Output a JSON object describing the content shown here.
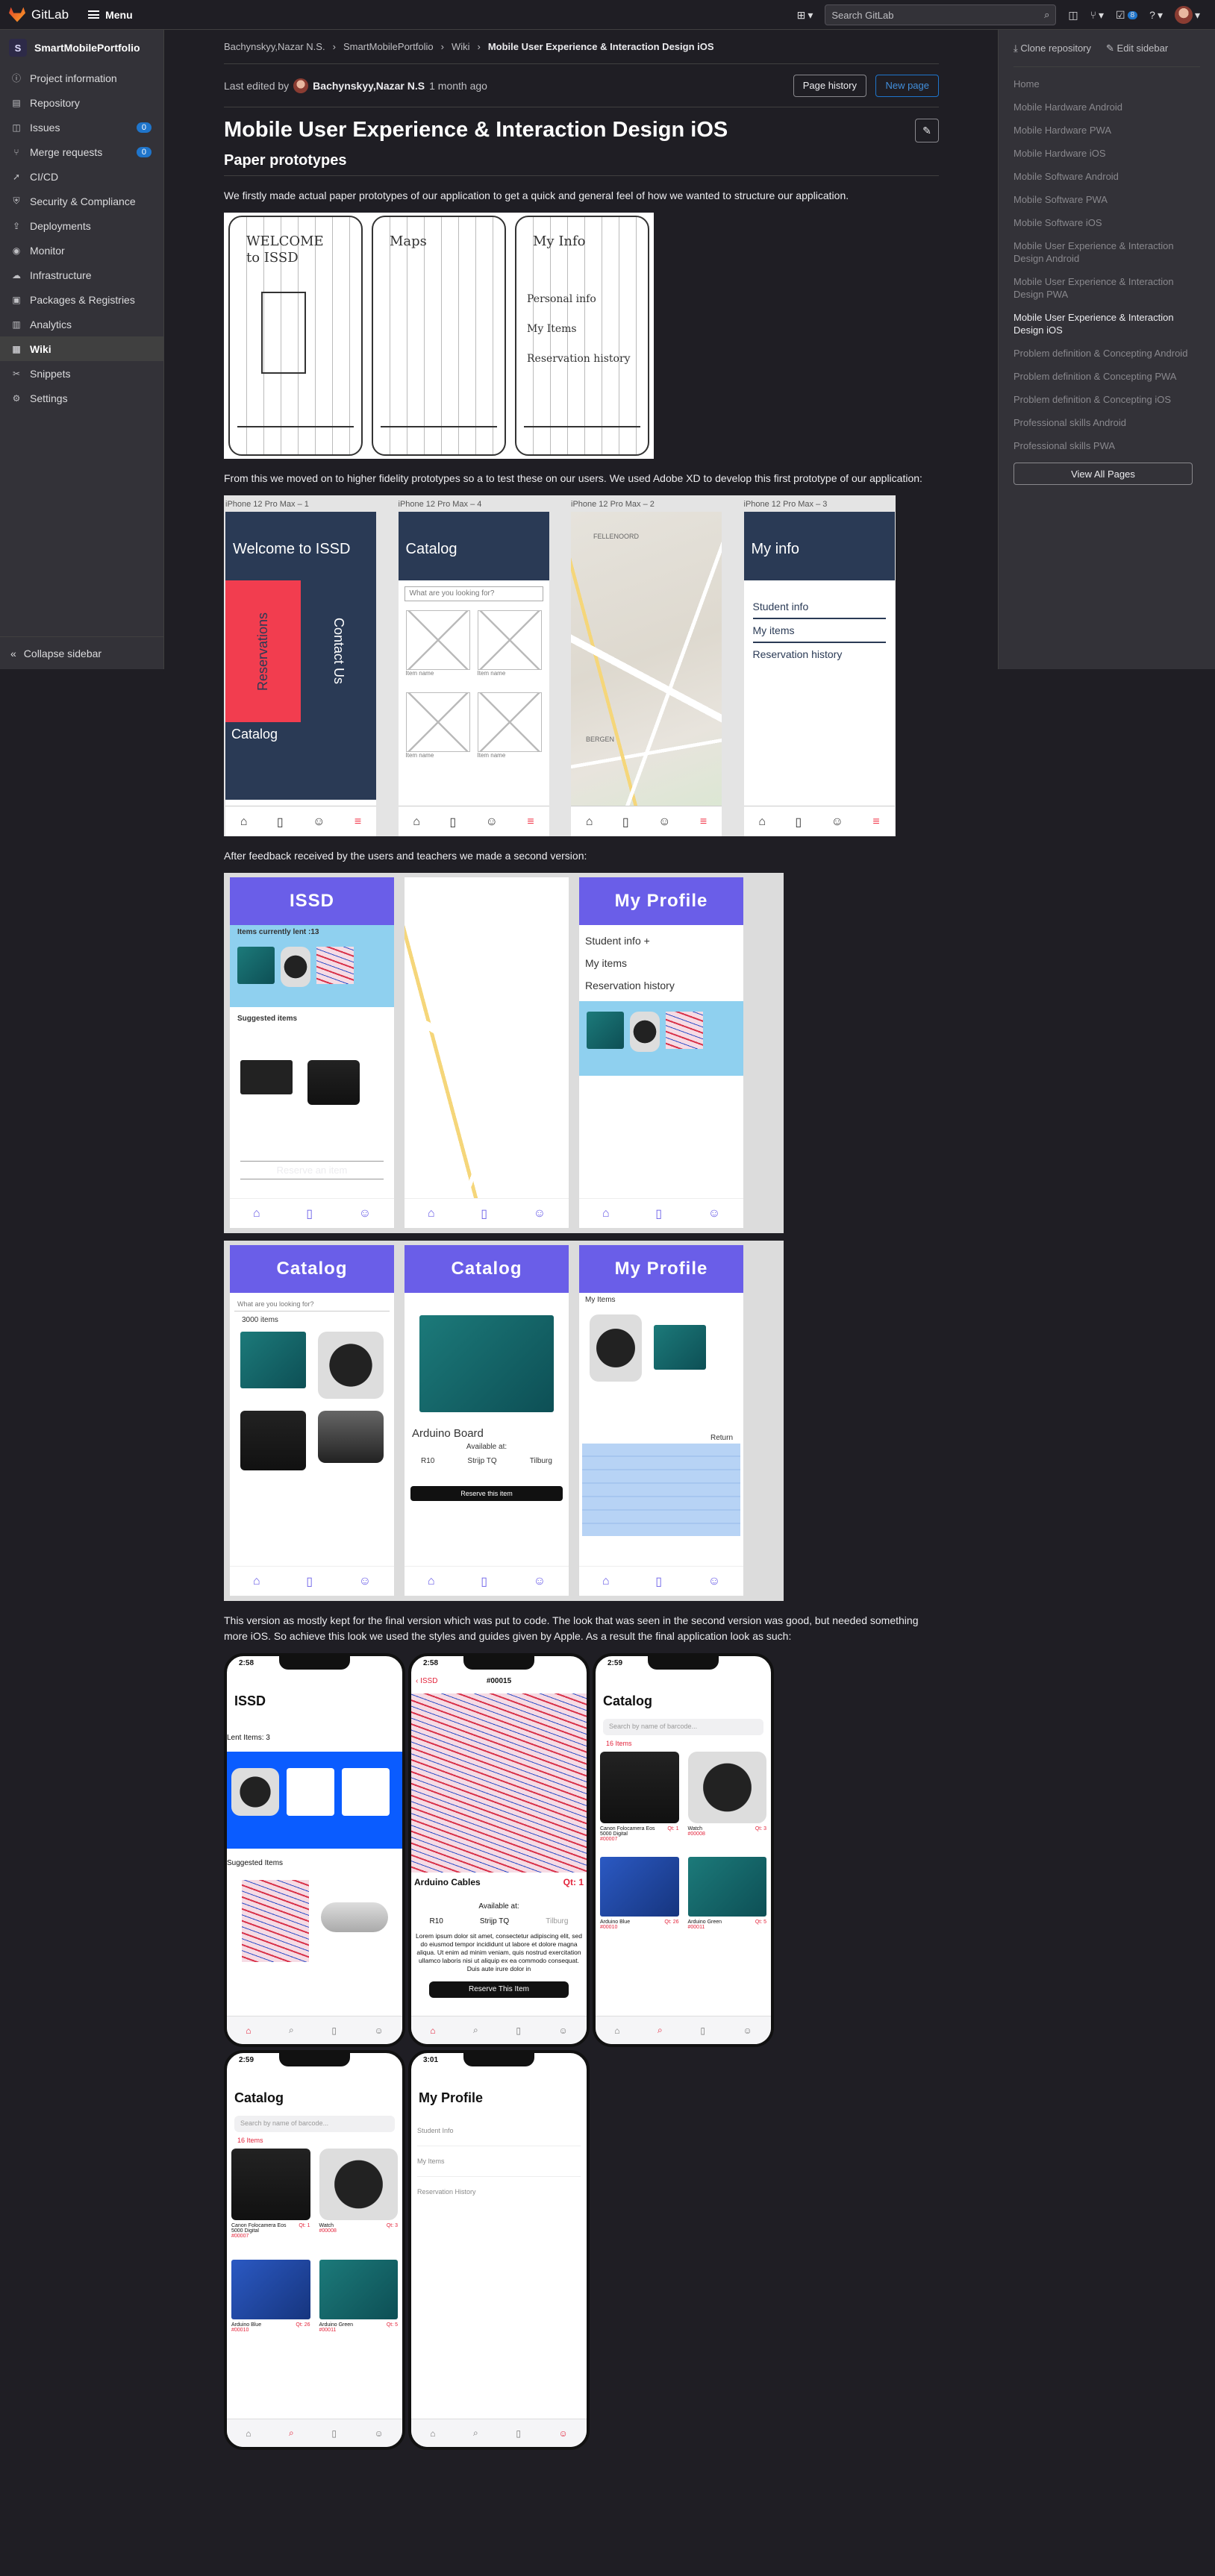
{
  "topbar": {
    "brand": "GitLab",
    "menu_label": "Menu",
    "search_placeholder": "Search GitLab",
    "todo_count": "8"
  },
  "sidebar": {
    "project_initial": "S",
    "project_name": "SmartMobilePortfolio",
    "items": [
      {
        "label": "Project information",
        "icon": "info-icon"
      },
      {
        "label": "Repository",
        "icon": "doc-icon"
      },
      {
        "label": "Issues",
        "icon": "issues-icon",
        "count": "0"
      },
      {
        "label": "Merge requests",
        "icon": "merge-icon",
        "count": "0"
      },
      {
        "label": "CI/CD",
        "icon": "rocket-icon"
      },
      {
        "label": "Security & Compliance",
        "icon": "shield-icon"
      },
      {
        "label": "Deployments",
        "icon": "deploy-icon"
      },
      {
        "label": "Monitor",
        "icon": "monitor-icon"
      },
      {
        "label": "Infrastructure",
        "icon": "cloud-icon"
      },
      {
        "label": "Packages & Registries",
        "icon": "package-icon"
      },
      {
        "label": "Analytics",
        "icon": "chart-icon"
      },
      {
        "label": "Wiki",
        "icon": "book-icon",
        "active": true
      },
      {
        "label": "Snippets",
        "icon": "snippet-icon"
      },
      {
        "label": "Settings",
        "icon": "gear-icon"
      }
    ],
    "collapse_label": "Collapse sidebar"
  },
  "breadcrumb": [
    "Bachynskyy,Nazar N.S.",
    "SmartMobilePortfolio",
    "Wiki",
    "Mobile User Experience & Interaction Design iOS"
  ],
  "header": {
    "last_edited_prefix": "Last edited by",
    "author": "Bachynskyy,Nazar N.S",
    "when": "1 month ago",
    "page_history": "Page history",
    "new_page": "New page"
  },
  "page": {
    "title": "Mobile User Experience & Interaction Design iOS",
    "section_title": "Paper prototypes",
    "p1": "We firstly made actual paper prototypes of our application to get a quick and general feel of how we wanted to structure our application.",
    "p2": "From this we moved on to higher fidelity prototypes so a to test these on our users. We used Adobe XD to develop this first prototype of our application:",
    "p3": "After feedback received by the users and teachers we made a second version:",
    "p4": "This version as mostly kept for the final version which was put to code. The look that was seen in the second version was good, but needed something more iOS. So achieve this look we used the styles and guides given by Apple. As a result the final application look as such:"
  },
  "sketch": {
    "s1": "WELCOME to ISSD",
    "s2": "Maps",
    "s3": "My Info",
    "s3_items": [
      "Personal info",
      "My Items",
      "Reservation history"
    ]
  },
  "xd": {
    "labels": [
      "iPhone 12 Pro Max – 1",
      "iPhone 12 Pro Max – 4",
      "iPhone 12 Pro Max – 2",
      "iPhone 12 Pro Max – 3"
    ],
    "welcome": "Welcome to ISSD",
    "reservations": "Reservations",
    "contact": "Contact Us",
    "catalog": "Catalog",
    "search": "What are you looking for?",
    "item_name": "Item name",
    "myinfo": "My info",
    "myinfo_items": [
      "Student info",
      "My items",
      "Reservation history"
    ],
    "map_labels": [
      "FELLENOORD",
      "BERGEN"
    ]
  },
  "v2": {
    "issd": "ISSD",
    "lent": "Items currently lent :13",
    "suggested": "Suggested items",
    "reserve": "Reserve an item",
    "profile": "My Profile",
    "profile_items": [
      "Student info +",
      "My items",
      "Reservation history"
    ],
    "catalog": "Catalog",
    "search": "What are you looking for?",
    "count": "3000 items",
    "detail_title": "Arduino Board",
    "available": "Available at:",
    "locations": [
      "R10",
      "Strijp TQ",
      "Tilburg"
    ],
    "reserve_this": "Reserve this item",
    "my_items": "My Items",
    "return": "Return"
  },
  "final": {
    "time1": "2:58",
    "time2": "2:59",
    "time3": "3:01",
    "issd": "ISSD",
    "lent": "Lent Items: 3",
    "suggested": "Suggested Items",
    "back": "ISSD",
    "detail_id": "#00015",
    "detail_name": "Arduino Cables",
    "detail_qty": "Qt: 1",
    "available": "Available at:",
    "locations": [
      "R10",
      "Strijp TQ",
      "Tilburg"
    ],
    "lorem": "Lorem ipsum dolor sit amet, consectetur adipiscing elit, sed do eiusmod tempor incididunt ut labore et dolore magna aliqua. Ut enim ad minim veniam, quis nostrud exercitation ullamco laboris nisi ut aliquip ex ea commodo consequat. Duis aute irure dolor in",
    "reserve": "Reserve This Item",
    "catalog": "Catalog",
    "search": "Search by name of barcode...",
    "count": "16 Items",
    "products": [
      {
        "name": "Canon Folocamera Eos 5000 Digital",
        "code": "#00007",
        "qty": "Qt: 1"
      },
      {
        "name": "Watch",
        "code": "#00008",
        "qty": "Qt: 3"
      },
      {
        "name": "Arduino Blue",
        "code": "#00010",
        "qty": "Qt: 26"
      },
      {
        "name": "Arduino Green",
        "code": "#00011",
        "qty": "Qt: 5"
      }
    ],
    "profile": "My Profile",
    "profile_items": [
      "Student Info",
      "My Items",
      "Reservation History"
    ]
  },
  "rside": {
    "clone": "Clone repository",
    "edit": "Edit sidebar",
    "pages": [
      "Home",
      "Mobile Hardware Android",
      "Mobile Hardware PWA",
      "Mobile Hardware iOS",
      "Mobile Software Android",
      "Mobile Software PWA",
      "Mobile Software iOS",
      "Mobile User Experience & Interaction Design Android",
      "Mobile User Experience & Interaction Design PWA",
      "Mobile User Experience & Interaction Design iOS",
      "Problem definition & Concepting Android",
      "Problem definition & Concepting PWA",
      "Problem definition & Concepting iOS",
      "Professional skills Android",
      "Professional skills PWA"
    ],
    "view_all": "View All Pages"
  }
}
